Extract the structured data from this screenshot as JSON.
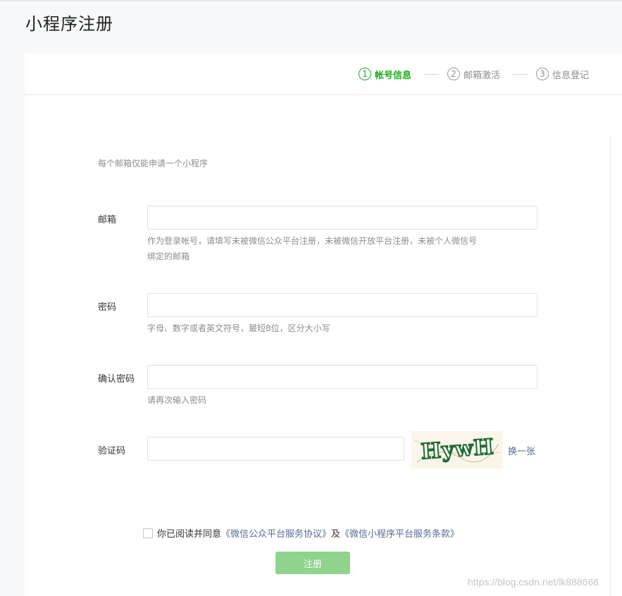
{
  "page": {
    "title": "小程序注册"
  },
  "steps": [
    {
      "number": "1",
      "label": "帐号信息",
      "state": "active"
    },
    {
      "number": "2",
      "label": "邮箱激活",
      "state": "pending"
    },
    {
      "number": "3",
      "label": "信息登记",
      "state": "pending"
    }
  ],
  "form": {
    "tip": "每个邮箱仅能申请一个小程序",
    "email": {
      "label": "邮箱",
      "value": "",
      "hint_line1": "作为登录帐号，请填写未被微信公众平台注册，未被微信开放平台注册，未被个人微信号",
      "hint_line2": "绑定的邮箱"
    },
    "password": {
      "label": "密码",
      "value": "",
      "hint": "字母、数字或者英文符号，最短8位，区分大小写"
    },
    "confirm_password": {
      "label": "确认密码",
      "value": "",
      "hint": "请再次输入密码"
    },
    "captcha": {
      "label": "验证码",
      "value": "",
      "image_text": "HywH",
      "refresh_label": "换一张"
    },
    "agreement": {
      "checked": false,
      "prefix": "你已阅读并同意",
      "link1": "《微信公众平台服务协议》",
      "middle": "及",
      "link2": "《微信小程序平台服务条款》"
    },
    "submit_label": "注册"
  },
  "watermark": "https://blog.csdn.net/lk888666",
  "colors": {
    "accent_green": "#1aad19",
    "button_disabled_green": "#8fd38d",
    "link_blue": "#576b95",
    "hint_gray": "#8d8d8d"
  }
}
